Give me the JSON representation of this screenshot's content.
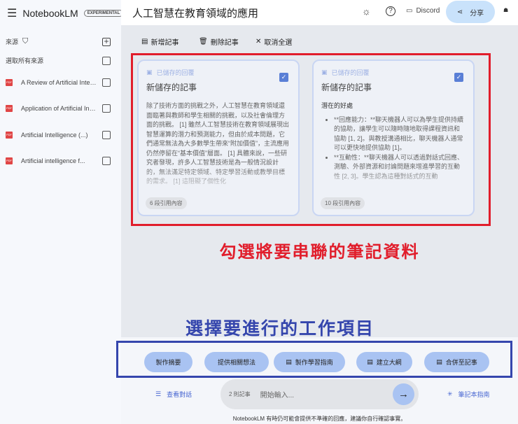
{
  "app": {
    "name": "NotebookLM",
    "badge": "EXPERIMENTAL"
  },
  "sidebar": {
    "sources_label": "來源",
    "select_all": "選取所有來源",
    "items": [
      {
        "label": "A Review of Artificial Intelligence"
      },
      {
        "label": "Application of Artificial Intelligence"
      },
      {
        "label": "Artificial Intelligence (...)"
      },
      {
        "label": "Artificial intelligence f..."
      }
    ]
  },
  "header": {
    "title": "人工智慧在教育領域的應用",
    "discord": "Discord",
    "share": "分享"
  },
  "toolbar": {
    "add": "新增記事",
    "delete": "刪除記事",
    "deselect": "取消全選"
  },
  "notes": [
    {
      "tag": "已儲存的回覆",
      "title": "新儲存的記事",
      "body": "除了技術方面的挑戰之外，人工智慧在教育領域還面臨著與教師和學生相關的挑戰，以及社會倫理方面的挑戰。 [1] 雖然人工智慧技術在教育領域展現出智慧運算的潛力和預測能力，但由於成本問題，它們通常無法為大多數學生帶來“附加價值”，主流應用仍然停留在“基本價值”層面。 [1] 具體來說，一些研究者發現，許多人工智慧技術是為一般情況設計的，無法滿足特定領域、特定學習活動或教學目標的需求。 [1] 這阻礙了個性化",
      "citations": "6 段引用內容",
      "checked": true
    },
    {
      "tag": "已儲存的回覆",
      "title": "新儲存的記事",
      "heading": "潛在的好處",
      "bullets": [
        "**回應能力：**聊天機器人可以為學生提供持續的協助，讓學生可以隨時隨地取得課程資訊和協助 [1, 2]。與教授溝通相比，聊天機器人通常可以更快地提供協助 [1]。",
        "**互動性：**聊天機器人可以透過對話式回應、測驗、外部資源和討論問題來增進學習的互動性 [2, 3]。學生認為這種對話式的互動"
      ],
      "citations": "10 段引用內容",
      "checked": true
    }
  ],
  "annotations": {
    "red": "勾選將要串聯的筆記資料",
    "blue": "選擇要進行的工作項目"
  },
  "actions": [
    "製作摘要",
    "提供相關想法",
    "製作學習指南",
    "建立大綱",
    "合併至記事"
  ],
  "chat": {
    "view_chat": "查看對話",
    "count": "2 則記事",
    "placeholder": "開始輸入...",
    "guide": "筆記本指南"
  },
  "footer": "NotebookLM 有時仍可能會提供不準確的回應，建議你自行確認事實。"
}
